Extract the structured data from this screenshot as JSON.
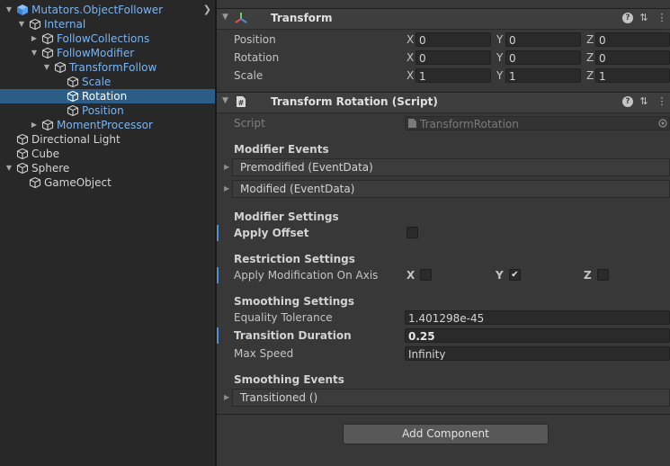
{
  "hierarchy": {
    "items": [
      {
        "label": "Mutators.ObjectFollower",
        "depth": 0,
        "expanded": true,
        "has_children": true,
        "color": "blue",
        "icon": "prefab-cube-icon",
        "selected": false
      },
      {
        "label": "Internal",
        "depth": 1,
        "expanded": true,
        "has_children": true,
        "color": "blue",
        "icon": "cube-icon",
        "selected": false
      },
      {
        "label": "FollowCollections",
        "depth": 2,
        "expanded": false,
        "has_children": true,
        "color": "blue",
        "icon": "cube-icon",
        "selected": false
      },
      {
        "label": "FollowModifier",
        "depth": 2,
        "expanded": true,
        "has_children": true,
        "color": "blue",
        "icon": "cube-icon",
        "selected": false
      },
      {
        "label": "TransformFollow",
        "depth": 3,
        "expanded": true,
        "has_children": true,
        "color": "blue",
        "icon": "cube-icon",
        "selected": false
      },
      {
        "label": "Scale",
        "depth": 4,
        "expanded": false,
        "has_children": false,
        "color": "blue",
        "icon": "cube-icon",
        "selected": false
      },
      {
        "label": "Rotation",
        "depth": 4,
        "expanded": false,
        "has_children": false,
        "color": "blue",
        "icon": "cube-icon",
        "selected": true
      },
      {
        "label": "Position",
        "depth": 4,
        "expanded": false,
        "has_children": false,
        "color": "blue",
        "icon": "cube-icon",
        "selected": false
      },
      {
        "label": "MomentProcessor",
        "depth": 2,
        "expanded": false,
        "has_children": true,
        "color": "blue",
        "icon": "cube-icon",
        "selected": false
      },
      {
        "label": "Directional Light",
        "depth": 0,
        "expanded": false,
        "has_children": false,
        "color": "white",
        "icon": "cube-icon",
        "selected": false
      },
      {
        "label": "Cube",
        "depth": 0,
        "expanded": false,
        "has_children": false,
        "color": "white",
        "icon": "cube-icon",
        "selected": false
      },
      {
        "label": "Sphere",
        "depth": 0,
        "expanded": true,
        "has_children": true,
        "color": "white",
        "icon": "cube-icon",
        "selected": false
      },
      {
        "label": "GameObject",
        "depth": 1,
        "expanded": false,
        "has_children": false,
        "color": "white",
        "icon": "cube-icon",
        "selected": false
      }
    ],
    "more_icon": "chevron-right-icon"
  },
  "transform": {
    "title": "Transform",
    "icon": "transform-icon",
    "position_label": "Position",
    "rotation_label": "Rotation",
    "scale_label": "Scale",
    "axis_x": "X",
    "axis_y": "Y",
    "axis_z": "Z",
    "position": {
      "x": "0",
      "y": "0",
      "z": "0"
    },
    "rotation": {
      "x": "0",
      "y": "0",
      "z": "0"
    },
    "scale": {
      "x": "1",
      "y": "1",
      "z": "1"
    }
  },
  "script_component": {
    "title": "Transform Rotation (Script)",
    "icon": "csharp-script-icon",
    "script_label": "Script",
    "script_value": "TransformRotation",
    "modifier_events_label": "Modifier Events",
    "premodified_label": "Premodified (EventData)",
    "modified_label": "Modified (EventData)",
    "modifier_settings_label": "Modifier Settings",
    "apply_offset_label": "Apply Offset",
    "apply_offset_checked": false,
    "restriction_settings_label": "Restriction Settings",
    "apply_modification_label": "Apply Modification On Axis",
    "axis_x_label": "X",
    "axis_y_label": "Y",
    "axis_z_label": "Z",
    "axis_x_checked": false,
    "axis_y_checked": true,
    "axis_z_checked": false,
    "smoothing_settings_label": "Smoothing Settings",
    "equality_tolerance_label": "Equality Tolerance",
    "equality_tolerance_value": "1.401298e-45",
    "transition_duration_label": "Transition Duration",
    "transition_duration_value": "0.25",
    "max_speed_label": "Max Speed",
    "max_speed_value": "Infinity",
    "smoothing_events_label": "Smoothing Events",
    "transitioned_label": "Transitioned ()"
  },
  "header_icons": {
    "help": "?",
    "settings": "⇅",
    "menu": "⋮"
  },
  "add_component_label": "Add Component",
  "colors": {
    "selection": "#2c5d87",
    "prefab_blue": "#7ab4f0",
    "modified_bar": "#4a90d9"
  }
}
